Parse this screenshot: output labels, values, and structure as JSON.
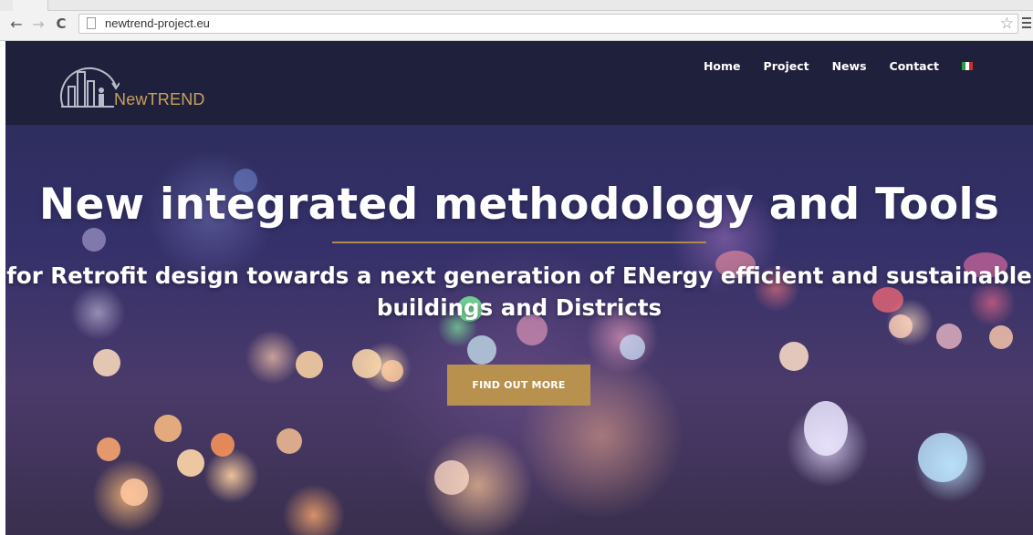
{
  "browser": {
    "url": "newtrend-project.eu",
    "icons": {
      "back": "arrow-left-icon",
      "forward": "arrow-right-icon",
      "reload": "reload-icon",
      "page": "page-icon",
      "bookmark": "star-icon",
      "menu": "hamburger-menu-icon"
    }
  },
  "site": {
    "logo_text": "NewTREND",
    "brand_color": "#c9a25b",
    "nav": {
      "items": [
        "Home",
        "Project",
        "News",
        "Contact"
      ],
      "language_flag": "italy-flag-icon"
    }
  },
  "hero": {
    "title": "New integrated methodology and Tools",
    "subtitle": "for Retrofit design towards a next generation of ENergy efficient and sustainable buildings and Districts",
    "cta_label": "FIND OUT MORE",
    "accent_color": "#b8914f"
  }
}
